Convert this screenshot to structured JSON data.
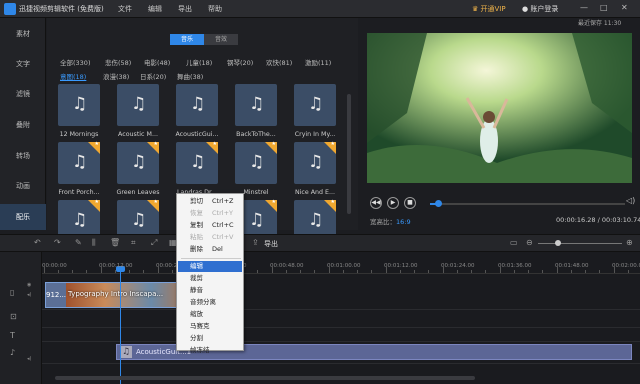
{
  "titlebar": {
    "app_name": "迅捷视频剪辑软件 (免费版)",
    "menus": [
      "文件",
      "编辑",
      "导出",
      "帮助"
    ],
    "vip": "开通VIP",
    "login": "账户登录",
    "min": "—",
    "max": "□",
    "close": "✕"
  },
  "save_time": "最近保存 11:30",
  "leftnav": [
    "素材",
    "文字",
    "滤镜",
    "叠附",
    "转场",
    "动画",
    "配乐"
  ],
  "library": {
    "type_tabs": [
      "音乐",
      "音效"
    ],
    "categories_row1": [
      "全部(330)",
      "悲伤(58)",
      "电影(48)",
      "儿童(18)",
      "钢琴(20)",
      "欢快(81)",
      "激励(11)"
    ],
    "categories_row2": [
      "意图(18)",
      "浪漫(38)",
      "日系(20)",
      "舞曲(38)"
    ],
    "tracks": [
      {
        "name": "12 Mornings",
        "premium": false
      },
      {
        "name": "Acoustic M...",
        "premium": false
      },
      {
        "name": "AcousticGui...",
        "premium": false
      },
      {
        "name": "BackToThe...",
        "premium": false
      },
      {
        "name": "Cryin In My...",
        "premium": false
      },
      {
        "name": "Front Porch...",
        "premium": true
      },
      {
        "name": "Green Leaves",
        "premium": true
      },
      {
        "name": "Landras Dr...",
        "premium": true
      },
      {
        "name": "Minstrel",
        "premium": true
      },
      {
        "name": "Nice And E...",
        "premium": true
      },
      {
        "name": "",
        "premium": true
      },
      {
        "name": "",
        "premium": true
      },
      {
        "name": "",
        "premium": true
      },
      {
        "name": "",
        "premium": true
      },
      {
        "name": "",
        "premium": true
      }
    ],
    "badge_glyph": "★",
    "note_glyph": "♫"
  },
  "preview": {
    "ratio_label": "宽高比：",
    "ratio_value": "16:9",
    "timecode": "00:00:16.28 / 00:03:10.74",
    "progress": 0.04,
    "controls": [
      "◀◀",
      "▶",
      "■"
    ]
  },
  "toolbar": {
    "export": "导出",
    "zoom_level": 0.24
  },
  "timeline": {
    "ruler": [
      "00:00:00",
      "00:00:12.00",
      "00:00:24.00",
      "00:00:36.00",
      "00:00:48.00",
      "00:01:00.00",
      "00:01:12.00",
      "00:01:24.00",
      "00:01:36.00",
      "00:01:48.00",
      "00:02:00.00"
    ],
    "video_clip_label": "912...",
    "video_clip_caption": "Typography Intro Inscapa...",
    "audio_clip_label": "AcousticGuit...1"
  },
  "context_menu": [
    {
      "label": "剪切",
      "shortcut": "Ctrl+Z",
      "disabled": false
    },
    {
      "label": "恢复",
      "shortcut": "Ctrl+Y",
      "disabled": true
    },
    {
      "label": "复制",
      "shortcut": "Ctrl+C",
      "disabled": false
    },
    {
      "label": "粘贴",
      "shortcut": "Ctrl+V",
      "disabled": true
    },
    {
      "label": "删除",
      "shortcut": "Del",
      "disabled": false
    },
    {
      "label": "编辑",
      "shortcut": "",
      "disabled": false,
      "highlighted": true
    },
    {
      "label": "裁剪",
      "shortcut": "",
      "disabled": false
    },
    {
      "label": "静音",
      "shortcut": "",
      "disabled": false
    },
    {
      "label": "音频分离",
      "shortcut": "",
      "disabled": false
    },
    {
      "label": "缩放",
      "shortcut": "",
      "disabled": false
    },
    {
      "label": "马赛克",
      "shortcut": "",
      "disabled": false
    },
    {
      "label": "分割",
      "shortcut": "",
      "disabled": false
    },
    {
      "label": "帧冻结",
      "shortcut": "",
      "disabled": false
    }
  ]
}
